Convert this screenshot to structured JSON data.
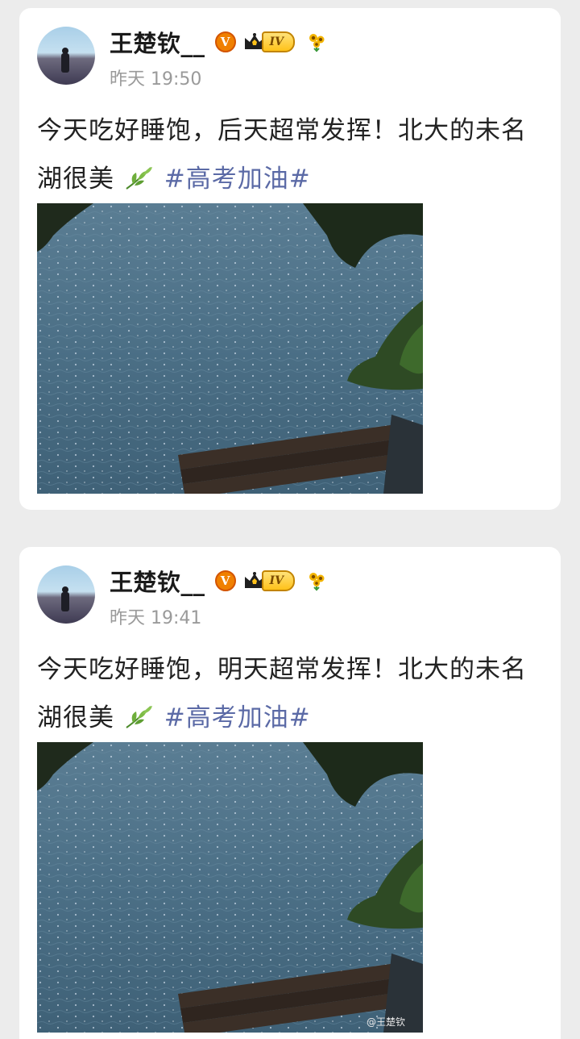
{
  "posts": [
    {
      "username": "王楚钦__",
      "verified_badge": "V",
      "level_badge": "IV",
      "timestamp": "昨天 19:50",
      "text": "今天吃好睡饱，后天超常发挥！北大的未名湖很美",
      "hashtag": "#高考加油#",
      "photo_watermark": ""
    },
    {
      "username": "王楚钦__",
      "verified_badge": "V",
      "level_badge": "IV",
      "timestamp": "昨天 19:41",
      "text": "今天吃好睡饱，明天超常发挥！北大的未名湖很美",
      "hashtag": "#高考加油#",
      "photo_watermark": "@王楚钦"
    }
  ],
  "icons": {
    "verified": "verified-v-icon",
    "level": "crown-level-icon",
    "flower": "sunflower-icon",
    "leaf": "herb-leaf-icon"
  },
  "colors": {
    "hashtag": "#5b6aa6",
    "verified": "#f08000",
    "level": "#ffc21a"
  }
}
